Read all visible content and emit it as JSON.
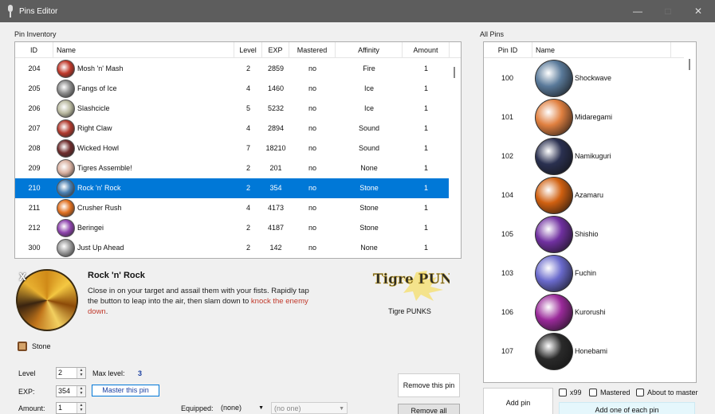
{
  "window": {
    "title": "Pins Editor",
    "minimize": "—",
    "maximize": "□",
    "close": "✕"
  },
  "inventory": {
    "label": "Pin Inventory",
    "columns": [
      "ID",
      "Name",
      "Level",
      "EXP",
      "Mastered",
      "Affinity",
      "Amount"
    ],
    "rows": [
      {
        "id": "204",
        "name": "Mosh 'n' Mash",
        "level": "2",
        "exp": "2859",
        "mastered": "no",
        "affinity": "Fire",
        "amount": "1",
        "color": "#c0392b"
      },
      {
        "id": "205",
        "name": "Fangs of Ice",
        "level": "4",
        "exp": "1460",
        "mastered": "no",
        "affinity": "Ice",
        "amount": "1",
        "color": "#8a8a8a"
      },
      {
        "id": "206",
        "name": "Slashcicle",
        "level": "5",
        "exp": "5232",
        "mastered": "no",
        "affinity": "Ice",
        "amount": "1",
        "color": "#b9b9a0"
      },
      {
        "id": "207",
        "name": "Right Claw",
        "level": "4",
        "exp": "2894",
        "mastered": "no",
        "affinity": "Sound",
        "amount": "1",
        "color": "#b03a2e"
      },
      {
        "id": "208",
        "name": "Wicked Howl",
        "level": "7",
        "exp": "18210",
        "mastered": "no",
        "affinity": "Sound",
        "amount": "1",
        "color": "#6e2c2c"
      },
      {
        "id": "209",
        "name": "Tigres Assemble!",
        "level": "2",
        "exp": "201",
        "mastered": "no",
        "affinity": "None",
        "amount": "1",
        "color": "#d8b0a0"
      },
      {
        "id": "210",
        "name": "Rock 'n' Rock",
        "level": "2",
        "exp": "354",
        "mastered": "no",
        "affinity": "Stone",
        "amount": "1",
        "color": "#4a7fb0"
      },
      {
        "id": "211",
        "name": "Crusher Rush",
        "level": "4",
        "exp": "4173",
        "mastered": "no",
        "affinity": "Stone",
        "amount": "1",
        "color": "#e07020"
      },
      {
        "id": "212",
        "name": "Beringei",
        "level": "2",
        "exp": "4187",
        "mastered": "no",
        "affinity": "Stone",
        "amount": "1",
        "color": "#8e44ad"
      },
      {
        "id": "300",
        "name": "Just Up Ahead",
        "level": "2",
        "exp": "142",
        "mastered": "no",
        "affinity": "None",
        "amount": "1",
        "color": "#9a9a9a"
      }
    ],
    "selected_index": 6
  },
  "detail": {
    "name": "Rock 'n' Rock",
    "desc_plain": "Close in on your target and assail them with your fists. Rapidly tap the button to leap into the air, then slam down to ",
    "desc_red": "knock the enemy down",
    "desc_end": ".",
    "brand_logo_text": "Tigre PUNKS",
    "brand": "Tigre PUNKS",
    "affinity": "Stone",
    "x_badge": "X"
  },
  "controls": {
    "level_label": "Level",
    "level_value": "2",
    "max_level_label": "Max level:",
    "max_level_value": "3",
    "exp_label": "EXP:",
    "exp_value": "354",
    "master_button": "Master this pin",
    "amount_label": "Amount:",
    "amount_value": "1",
    "equipped_label": "Equipped:",
    "equipped_value": "(none)",
    "equipped_slot": "(no one)",
    "remove_pin": "Remove this pin",
    "remove_all": "Remove all"
  },
  "all_pins": {
    "label": "All Pins",
    "columns": [
      "Pin ID",
      "Name"
    ],
    "rows": [
      {
        "id": "100",
        "name": "Shockwave",
        "color": "#5a7a9a"
      },
      {
        "id": "101",
        "name": "Midaregami",
        "color": "#e08040"
      },
      {
        "id": "102",
        "name": "Namikuguri",
        "color": "#2a3050"
      },
      {
        "id": "104",
        "name": "Azamaru",
        "color": "#d06010"
      },
      {
        "id": "105",
        "name": "Shishio",
        "color": "#7030a0"
      },
      {
        "id": "103",
        "name": "Fuchin",
        "color": "#6a6acc"
      },
      {
        "id": "106",
        "name": "Kurorushi",
        "color": "#9a2a9a"
      },
      {
        "id": "107",
        "name": "Honebami",
        "color": "#2a2a2a"
      }
    ],
    "add_pin": "Add pin",
    "x99": "x99",
    "mastered": "Mastered",
    "about_to_master": "About to master",
    "add_one_each": "Add one of each pin"
  }
}
